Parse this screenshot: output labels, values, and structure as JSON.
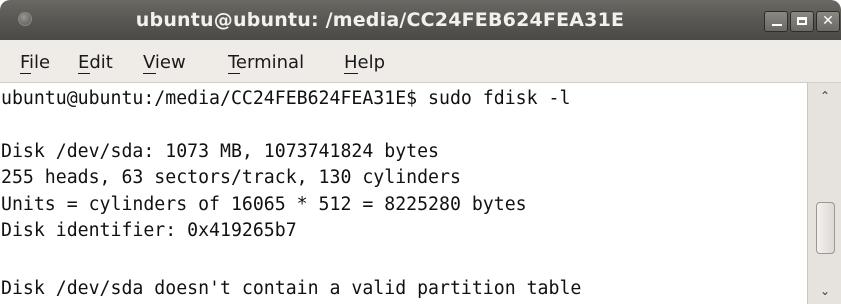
{
  "window": {
    "title": "ubuntu@ubuntu: /media/CC24FEB624FEA31E",
    "buttons": {
      "minimize_icon": "minimize-icon",
      "maximize_icon": "maximize-icon",
      "close_label": "✕"
    }
  },
  "menu": [
    {
      "label": "File",
      "mnemonic": "F"
    },
    {
      "label": "Edit",
      "mnemonic": "E"
    },
    {
      "label": "View",
      "mnemonic": "V"
    },
    {
      "label": "Terminal",
      "mnemonic": "T"
    },
    {
      "label": "Help",
      "mnemonic": "H"
    }
  ],
  "terminal": {
    "lines": [
      "ubuntu@ubuntu:/media/CC24FEB624FEA31E$ sudo fdisk -l",
      "",
      "Disk /dev/sda: 1073 MB, 1073741824 bytes",
      "255 heads, 63 sectors/track, 130 cylinders",
      "Units = cylinders of 16065 * 512 = 8225280 bytes",
      "Disk identifier: 0x419265b7",
      "",
      "Disk /dev/sda doesn't contain a valid partition table"
    ]
  },
  "scrollbar": {
    "up_arrow": "⌃",
    "down_arrow": "⌄"
  },
  "colors": {
    "titlebar": "#5b5954",
    "menubar": "#efebe7",
    "terminal_bg": "#ffffff",
    "text": "#111111"
  }
}
